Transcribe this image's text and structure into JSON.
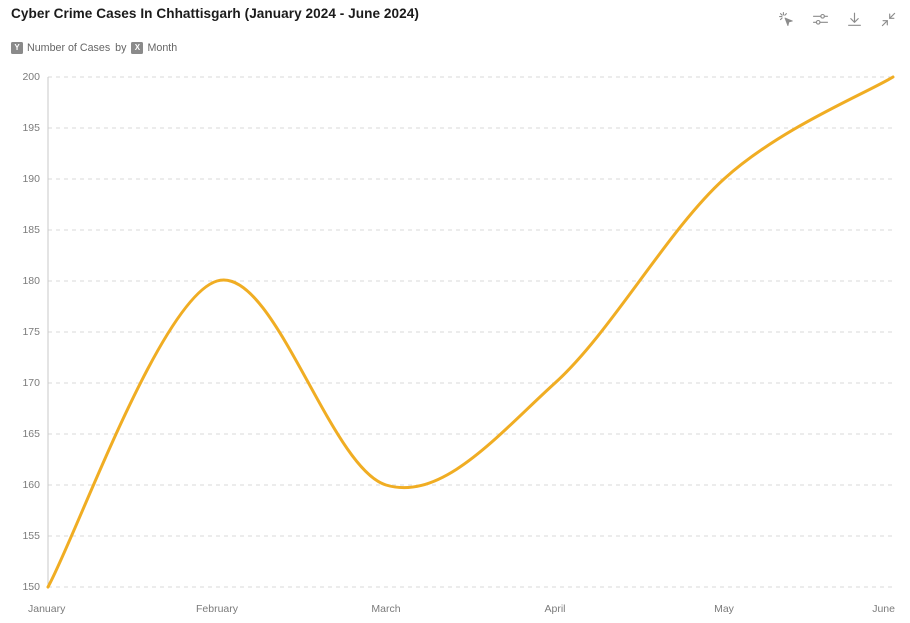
{
  "header": {
    "title": "Cyber Crime Cases In Chhattisgarh (January 2024 - June 2024)",
    "subtitle_measure": "Number of Cases",
    "subtitle_connector": "by",
    "subtitle_dimension": "Month",
    "y_badge": "Y",
    "x_badge": "X"
  },
  "toolbar": {
    "items": [
      {
        "name": "interact-icon",
        "label": "Interact"
      },
      {
        "name": "filter-icon",
        "label": "Filter"
      },
      {
        "name": "download-icon",
        "label": "Download"
      },
      {
        "name": "collapse-icon",
        "label": "Collapse"
      }
    ]
  },
  "colors": {
    "line": "#F0AD23",
    "gridline": "#d9d9d9",
    "axis": "#c9c9c9",
    "tick_text": "#7b7b7b",
    "title_text": "#1b1b1b",
    "badge_bg": "#8a8a8a",
    "background": "#ffffff"
  },
  "chart_data": {
    "type": "line",
    "title": "Cyber Crime Cases In Chhattisgarh (January 2024 - June 2024)",
    "xlabel": "Month",
    "ylabel": "Number of Cases",
    "categories": [
      "January",
      "February",
      "March",
      "April",
      "May",
      "June"
    ],
    "values": [
      150,
      180,
      160,
      170,
      190,
      200
    ],
    "series": [
      {
        "name": "Number of Cases",
        "values": [
          150,
          180,
          160,
          170,
          190,
          200
        ],
        "color": "#F0AD23"
      }
    ],
    "ylim": [
      150,
      200
    ],
    "ytick_step": 5,
    "yticks": [
      150,
      155,
      160,
      165,
      170,
      175,
      180,
      185,
      190,
      195,
      200
    ],
    "xticks": [
      "January",
      "February",
      "March",
      "April",
      "May",
      "June"
    ],
    "grid": true,
    "grid_style": "dashed-horizontal",
    "legend": false,
    "legend_position": "none",
    "line_style": "smooth-spline",
    "line_width": 3,
    "markers": false
  }
}
